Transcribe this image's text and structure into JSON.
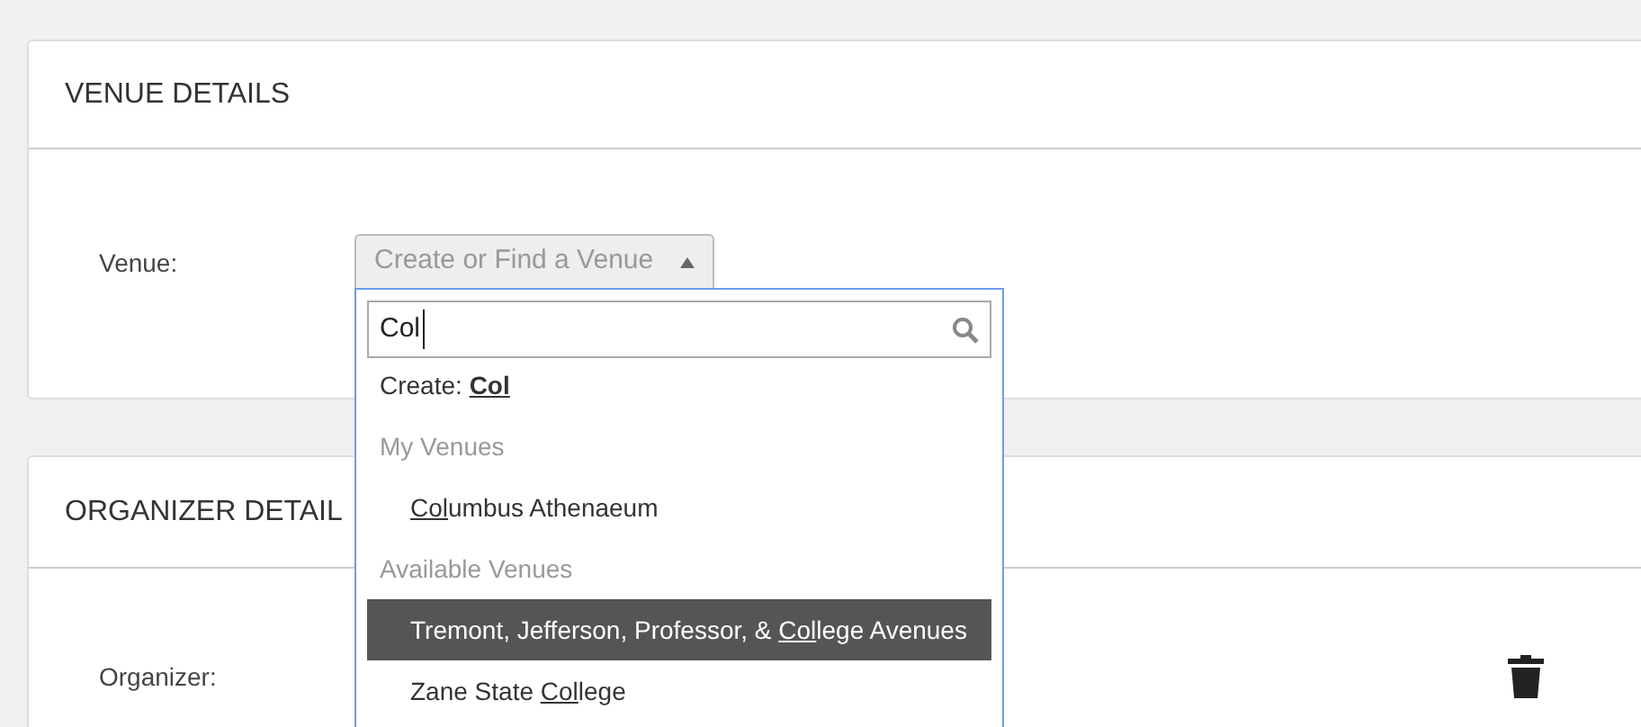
{
  "venue_section": {
    "title": "VENUE DETAILS",
    "label": "Venue:",
    "select": {
      "placeholder": "Create or Find a Venue",
      "expanded": true
    },
    "dropdown": {
      "search": {
        "value": "Col"
      },
      "options": [
        {
          "kind": "create",
          "text": "Create: **Col**"
        },
        {
          "kind": "group",
          "text": "My Venues"
        },
        {
          "kind": "option",
          "match": "Col",
          "after": "umbus Athenaeum",
          "selected": false
        },
        {
          "kind": "group",
          "text": "Available Venues"
        },
        {
          "kind": "option",
          "before": "Tremont, Jefferson, Professor, & ",
          "match": "Col",
          "after": "lege Avenues",
          "selected": true
        },
        {
          "kind": "option",
          "before": "Zane State ",
          "match": "Col",
          "after": "lege",
          "selected": false
        }
      ]
    }
  },
  "organizer_section": {
    "title": "ORGANIZER DETAIL",
    "label": "Organizer:"
  }
}
